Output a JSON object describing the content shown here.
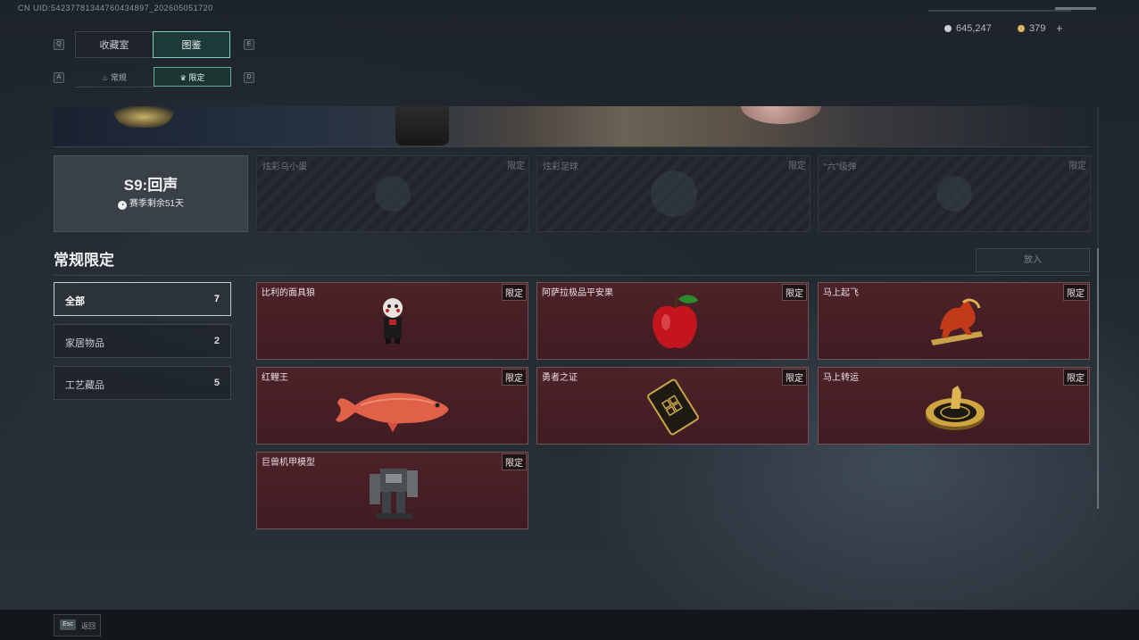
{
  "uid": "CN UID:54237781344760434897_202605051720",
  "tabs": {
    "left_key": "Q",
    "right_key": "E",
    "items": [
      "收藏室",
      "图鉴"
    ],
    "active": 1
  },
  "subtabs": {
    "left_key": "A",
    "right_key": "D",
    "items": [
      "常规",
      "限定"
    ],
    "active": 1
  },
  "currency": {
    "silver": "645,247",
    "gold": "379",
    "add": "+"
  },
  "season": {
    "title": "S9:回声",
    "remaining": "赛季剩余51天"
  },
  "locked_items": [
    {
      "name": "炫彩乌小蛋",
      "badge": "限定"
    },
    {
      "name": "炫彩足球",
      "badge": "限定"
    },
    {
      "name": "“六”级弹",
      "badge": "限定"
    }
  ],
  "section_title": "常规限定",
  "put_button": "放入",
  "filters": [
    {
      "label": "全部",
      "count": "7"
    },
    {
      "label": "家居物品",
      "count": "2"
    },
    {
      "label": "工艺藏品",
      "count": "5"
    }
  ],
  "items": [
    {
      "name": "比利的面具狼",
      "badge": "限定",
      "icon": "puppet-icon"
    },
    {
      "name": "阿萨拉极品平安果",
      "badge": "限定",
      "icon": "apple-icon"
    },
    {
      "name": "马上起飞",
      "badge": "限定",
      "icon": "horse-statue-icon"
    },
    {
      "name": "红鲤王",
      "badge": "限定",
      "icon": "carp-icon"
    },
    {
      "name": "勇者之证",
      "badge": "限定",
      "icon": "badge-card-icon"
    },
    {
      "name": "马上转运",
      "badge": "限定",
      "icon": "horse-disk-icon"
    },
    {
      "name": "巨兽机甲模型",
      "badge": "限定",
      "icon": "mech-model-icon"
    }
  ],
  "footer": {
    "key": "Esc",
    "label": "返回"
  },
  "colors": {
    "accent": "#7fd0b4",
    "item_bg": "#4b2228",
    "item_border": "#6e5457"
  }
}
